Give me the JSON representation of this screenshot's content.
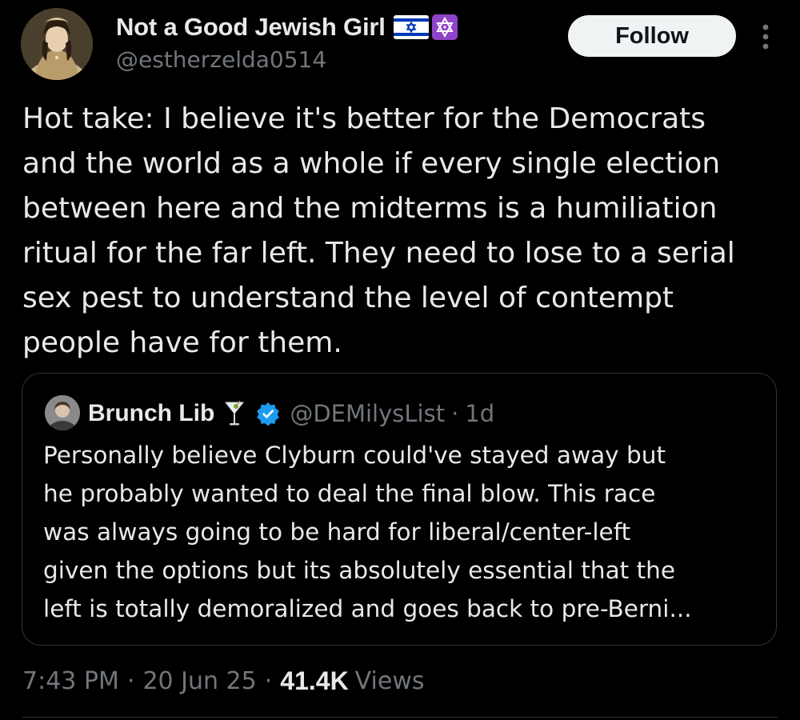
{
  "author": {
    "display_name": "Not a Good Jewish Girl",
    "handle": "@estherzelda0514",
    "flag_icon": "israel-flag-icon",
    "star_icon": "star-of-david-icon"
  },
  "actions": {
    "follow_label": "Follow",
    "more_icon": "more-vertical-icon"
  },
  "tweet": {
    "text": "Hot take: I believe it's better for the Democrats\nand the world as a whole if every single election\nbetween here and the midterms is a humiliation\nritual for the far left. They need to lose to a serial\nsex pest to understand the level of contempt\npeople have for them."
  },
  "quote": {
    "display_name": "Brunch Lib",
    "glass_icon": "cocktail-glass-icon",
    "verified_icon": "verified-badge-icon",
    "handle": "@DEMilysList",
    "time": "1d",
    "text": "Personally believe Clyburn could've stayed away but\nhe probably wanted to deal the final blow. This race\nwas always going to be hard for liberal/center-left\ngiven the options but its absolutely essential that the\nleft is totally demoralized and goes back to pre-Berni..."
  },
  "meta": {
    "time": "7:43 PM",
    "date": "20 Jun 25",
    "views_count": "41.4K",
    "views_label": "Views"
  },
  "colors": {
    "background": "#000000",
    "text_primary": "#e7e9ea",
    "text_secondary": "#71767b",
    "border": "#2f3336",
    "verified_blue": "#1d9bf0",
    "follow_bg": "#eff3f4"
  }
}
